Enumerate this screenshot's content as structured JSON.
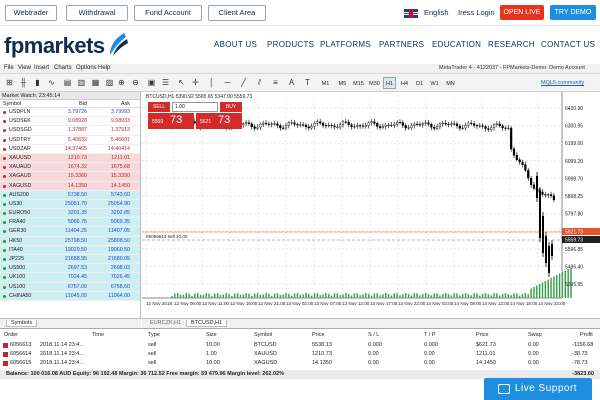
{
  "topbar": {
    "webtrader": "Webtrader",
    "withdrawal": "Withdrawal",
    "fund_account": "Fund Account",
    "client_area": "Client Area",
    "language": "English",
    "login": "Iress Login",
    "open_live": "OPEN LIVE",
    "try_demo": "TRY DEMO"
  },
  "nav": {
    "logo": "fpmarkets",
    "items": [
      "ABOUT US",
      "PRODUCTS",
      "PLATFORMS",
      "PARTNERS",
      "EDUCATION",
      "RESEARCH",
      "CONTACT US"
    ]
  },
  "mt_menu": [
    "File",
    "View",
    "Insert",
    "Charts",
    "Options",
    "Help"
  ],
  "toolbar": {
    "timeframes": [
      "M1",
      "M5",
      "M15",
      "M30",
      "H1",
      "H4",
      "D1",
      "W1",
      "MN"
    ],
    "active_timeframe": "H1",
    "account_info": "MetaTrader 4 - 4122037 - FPMarkets-Demo: Demo Account",
    "mql5": "MQL5.community"
  },
  "market_watch": {
    "title": "Market Watch: 23:45:14",
    "headers": {
      "symbol": "Symbol",
      "bid": "Bid",
      "ask": "Ask"
    },
    "rows": [
      {
        "symbol": "USDPLN",
        "bid": "3.79726",
        "ask": "3.79993",
        "type": "fx",
        "dir": "pos"
      },
      {
        "symbol": "USDSEK",
        "bid": "9.08928",
        "ask": "9.08933",
        "type": "fx",
        "dir": "neg"
      },
      {
        "symbol": "USDSGD",
        "bid": "1.37887",
        "ask": "1.37913",
        "type": "fx",
        "dir": "neg"
      },
      {
        "symbol": "USDTRY",
        "bid": "5.46632",
        "ask": "5.46691",
        "type": "fx",
        "dir": "neg"
      },
      {
        "symbol": "USDZAR",
        "bid": "14.37465",
        "ask": "14.40414",
        "type": "fx",
        "dir": "neg"
      },
      {
        "symbol": "XAUUSD",
        "bid": "1210.73",
        "ask": "1211.01",
        "type": "metal",
        "dir": "neg"
      },
      {
        "symbol": "XAUAUD",
        "bid": "1674.32",
        "ask": "1675.68",
        "type": "metal",
        "dir": "neg"
      },
      {
        "symbol": "XAGAUD",
        "bid": "15.3360",
        "ask": "15.3390",
        "type": "metal",
        "dir": "neg"
      },
      {
        "symbol": "XAGUSD",
        "bid": "14.1350",
        "ask": "14.1450",
        "type": "metal",
        "dir": "neg"
      },
      {
        "symbol": "AUS200",
        "bid": "5738.50",
        "ask": "5743.60",
        "type": "idx",
        "dir": "pos"
      },
      {
        "symbol": "US30",
        "bid": "25051.70",
        "ask": "25054.90",
        "type": "idx",
        "dir": "pos"
      },
      {
        "symbol": "EURO50",
        "bid": "3201.35",
        "ask": "3202.85",
        "type": "idx",
        "dir": "pos"
      },
      {
        "symbol": "FRA40",
        "bid": "5066.75",
        "ask": "5069.35",
        "type": "idx",
        "dir": "pos"
      },
      {
        "symbol": "GER30",
        "bid": "11404.25",
        "ask": "11407.05",
        "type": "idx",
        "dir": "pos"
      },
      {
        "symbol": "HK50",
        "bid": "25798.50",
        "ask": "25808.50",
        "type": "idx",
        "dir": "pos"
      },
      {
        "symbol": "ITA40",
        "bid": "19029.50",
        "ask": "19060.50",
        "type": "idx",
        "dir": "pos"
      },
      {
        "symbol": "JP225",
        "bid": "21688.95",
        "ask": "21680.05",
        "type": "idx",
        "dir": "pos"
      },
      {
        "symbol": "US500",
        "bid": "2697.53",
        "ask": "2698.03",
        "type": "idx",
        "dir": "pos"
      },
      {
        "symbol": "UK100",
        "bid": "7024.45",
        "ask": "7026.45",
        "type": "idx",
        "dir": "pos"
      },
      {
        "symbol": "US100",
        "bid": "6757.00",
        "ask": "6758.60",
        "type": "idx",
        "dir": "pos"
      },
      {
        "symbol": "CHINA50",
        "bid": "11045.00",
        "ask": "11064.00",
        "type": "idx",
        "dir": "pos"
      }
    ],
    "tab": "Symbols"
  },
  "chart": {
    "title": "BTCUSD,H1  5390.92 5565.65 5347.00 5559.73",
    "sell_label": "SELL",
    "buy_label": "BUY",
    "lot": "1.00",
    "sell_small": "5559",
    "sell_big": "73",
    "buy_small": "5621",
    "buy_big": "73",
    "order_label": "#6056613 sell 10.00",
    "price_labels": [
      "6430.90",
      "6300.95",
      "6199.00",
      "6099.20",
      "5998.70",
      "5898.25",
      "5797.80",
      "5697.30",
      "5596.85",
      "5496.40",
      "5395.95"
    ],
    "price_marker_red": "5621.73",
    "price_marker_dark": "5559.73",
    "time_labels": [
      "12 Nov 2018",
      "12 Nov 06:00",
      "12 Nov 11:00",
      "12 Nov 16:00",
      "12 Nov 21:00",
      "13 Nov 02:00",
      "13 Nov 07:00",
      "13 Nov 12:00",
      "13 Nov 17:00",
      "13 Nov 22:00",
      "14 Nov 03:00",
      "14 Nov 08:00",
      "14 Nov 13:00",
      "14 Nov 18:00",
      "14 Nov 23:00"
    ],
    "tabs": [
      "EURCZK,H1",
      "BTCUSD,H1"
    ]
  },
  "orders": {
    "headers": [
      "Order",
      "Time",
      "Type",
      "Size",
      "Symbol",
      "Price",
      "S / L",
      "T / P",
      "Price",
      "Swap",
      "Profit"
    ],
    "rows": [
      [
        "6056613",
        "2018.11.14 23:4...",
        "sell",
        "10.00",
        "BTCUSD",
        "5538.13",
        "0.000",
        "0.000",
        "$621.73",
        "0.00",
        "-1156.68"
      ],
      [
        "6056614",
        "2018.11.14 23:4...",
        "sell",
        "1.00",
        "XAUUSD",
        "1210.73",
        "0.00",
        "0.00",
        "1211.01",
        "0.00",
        "-38.73"
      ],
      [
        "6056615",
        "2018.11.14 23:4...",
        "sell",
        "10.00",
        "XAGUSD",
        "14.1350",
        "0.00",
        "0.00",
        "14.1450",
        "0.00",
        "-78.73"
      ]
    ],
    "balance": "Balance: 100 016.08 AUD  Equity: 96 192.48  Margin: 36 712.52  Free margin: 59 479.96  Margin level: 262.02%",
    "total": "-3823.60"
  },
  "live_support": "Live Support",
  "colors": {
    "red": "#e8341c",
    "blue": "#1e8ee0",
    "navy": "#0f2d4f"
  }
}
